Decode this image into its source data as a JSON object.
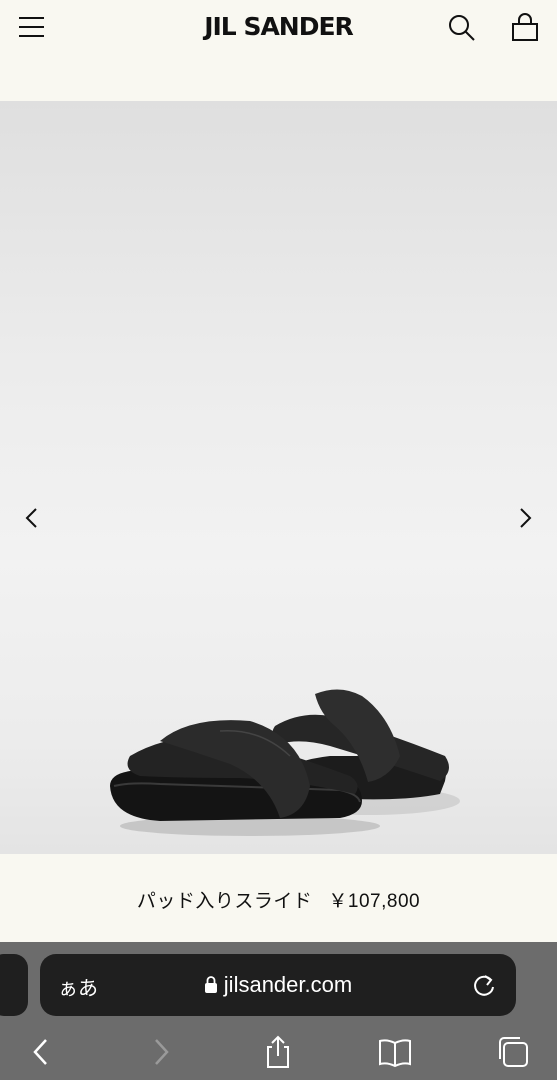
{
  "header": {
    "logo": "JIL SANDER",
    "menu_icon": "hamburger-menu-icon",
    "search_icon": "search-icon",
    "bag_icon": "shopping-bag-icon"
  },
  "gallery": {
    "prev_icon": "chevron-left-icon",
    "next_icon": "chevron-right-icon",
    "image": "black padded leather crossover slide sandals"
  },
  "product": {
    "name": "パッド入りスライド",
    "price": "￥107,800"
  },
  "browser": {
    "text_size_label": "ぁあ",
    "url": "jilsander.com",
    "lock_icon": "lock-icon",
    "reload_icon": "reload-icon",
    "toolbar": [
      "back-icon",
      "forward-icon",
      "share-icon",
      "bookmarks-icon",
      "tabs-icon"
    ],
    "bar_color": "#6c6c6c",
    "field_color": "#1f1f1f"
  }
}
